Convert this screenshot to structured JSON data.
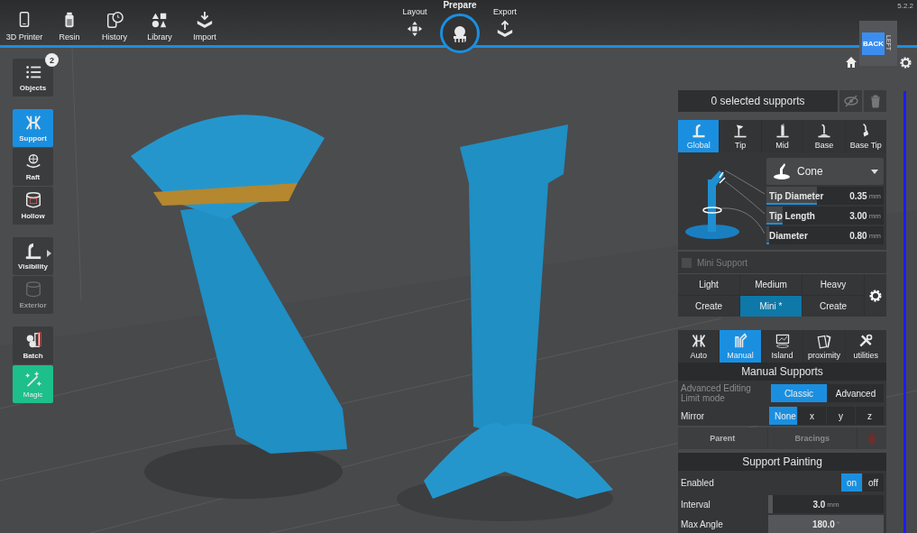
{
  "top_bar": {
    "tools": [
      {
        "label": "3D Printer"
      },
      {
        "label": "Resin"
      },
      {
        "label": "History"
      },
      {
        "label": "Library"
      },
      {
        "label": "Import"
      }
    ],
    "modes": [
      {
        "label": "Layout",
        "selected": false
      },
      {
        "label": "Prepare",
        "selected": true
      },
      {
        "label": "Export",
        "selected": false
      }
    ],
    "version": "5.2.2"
  },
  "view_cube": {
    "front_face": "BACK",
    "side_face": "LEFT"
  },
  "left_toolbar": {
    "groups": [
      [
        {
          "label": "Objects",
          "kind": "tool",
          "selected": false,
          "disabled": false,
          "badge": "2"
        }
      ],
      [
        {
          "label": "Support",
          "kind": "tool",
          "selected": true,
          "disabled": false
        },
        {
          "label": "Raft",
          "kind": "tool",
          "selected": false,
          "disabled": false
        },
        {
          "label": "Hollow",
          "kind": "tool",
          "selected": false,
          "disabled": false
        }
      ],
      [
        {
          "label": "Visibility",
          "kind": "menu",
          "selected": false,
          "disabled": false
        },
        {
          "label": "Exterior",
          "kind": "tool",
          "selected": false,
          "disabled": true
        }
      ],
      [
        {
          "label": "Batch",
          "kind": "tool",
          "selected": false,
          "disabled": false
        },
        {
          "label": "Magic",
          "kind": "action",
          "selected": false,
          "disabled": false
        }
      ]
    ]
  },
  "selection_bar": {
    "text": "0 selected supports"
  },
  "support_tabs": [
    {
      "label": "Global",
      "selected": true
    },
    {
      "label": "Tip",
      "selected": false
    },
    {
      "label": "Mid",
      "selected": false
    },
    {
      "label": "Base",
      "selected": false
    },
    {
      "label": "Base Tip",
      "selected": false
    }
  ],
  "support_shape": {
    "value": "Cone"
  },
  "parameters": [
    {
      "label": "Tip Diameter",
      "value": "0.35",
      "unit": "mm",
      "level": 0.43
    },
    {
      "label": "Tip Length",
      "value": "3.00",
      "unit": "mm",
      "level": 0.14
    },
    {
      "label": "Diameter",
      "value": "0.80",
      "unit": "mm",
      "level": 0.02
    }
  ],
  "mini_support": {
    "label": "Mini Support",
    "checked": false,
    "disabled": true
  },
  "presets": [
    [
      {
        "label": "Light",
        "selected": false
      },
      {
        "label": "Medium",
        "selected": false
      },
      {
        "label": "Heavy",
        "selected": false
      }
    ],
    [
      {
        "label": "Create",
        "selected": false
      },
      {
        "label": "Mini *",
        "selected": true
      },
      {
        "label": "Create",
        "selected": false
      }
    ]
  ],
  "mode_tabs": [
    {
      "label": "Auto",
      "selected": false
    },
    {
      "label": "Manual",
      "selected": true
    },
    {
      "label": "Island",
      "selected": false
    },
    {
      "label": "proximity",
      "selected": false
    },
    {
      "label": "utilities",
      "selected": false
    }
  ],
  "manual_supports": {
    "title": "Manual Supports",
    "limit_mode": {
      "label": "Advanced Editing Limit mode",
      "disabled": true,
      "options": [
        {
          "label": "Classic",
          "selected": true
        },
        {
          "label": "Advanced",
          "selected": false
        }
      ]
    },
    "mirror": {
      "label": "Mirror",
      "options": [
        {
          "label": "None",
          "selected": true
        },
        {
          "label": "x",
          "selected": false
        },
        {
          "label": "y",
          "selected": false
        },
        {
          "label": "z",
          "selected": false
        }
      ]
    },
    "actions": [
      {
        "label": "Parent",
        "disabled": false
      },
      {
        "label": "Bracings",
        "disabled": true
      }
    ],
    "delete_disabled": true
  },
  "support_painting": {
    "title": "Support Painting",
    "enabled": {
      "label": "Enabled",
      "options": [
        {
          "label": "on",
          "selected": true
        },
        {
          "label": "off",
          "selected": false
        }
      ]
    },
    "fields": [
      {
        "label": "Interval",
        "value": "3.0",
        "unit": "mm",
        "level": 0.04
      },
      {
        "label": "Max Angle",
        "value": "180.0",
        "unit": "°",
        "level": 1
      }
    ]
  }
}
